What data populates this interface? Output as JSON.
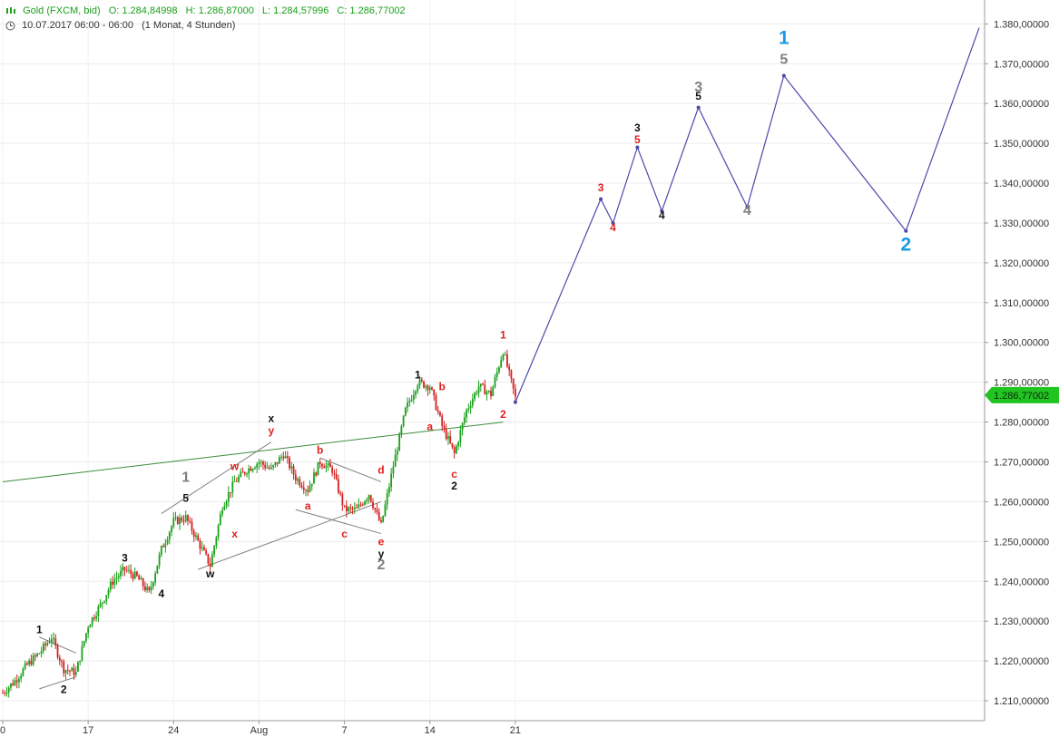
{
  "header": {
    "instrument": "Gold (FXCM, bid)",
    "open": "O: 1.284,84998",
    "high": "H: 1.286,87000",
    "low": "L: 1.284,57996",
    "close": "C: 1.286,77002",
    "date_range": "10.07.2017 06:00 - 06:00",
    "timeframe": "(1 Monat, 4 Stunden)",
    "icon": "candlestick-icon",
    "clock_icon": "clock-icon"
  },
  "colors": {
    "up_candle": "#1aa01a",
    "down_candle": "#d42020",
    "projection": "#4a4aaa",
    "trendline": "#3c8c3c",
    "channel": "#808080",
    "label_red": "#e02020",
    "label_black": "#111111",
    "label_gray": "#808080",
    "label_blue": "#1a9ae6",
    "price_tag": "#22c422"
  },
  "chart_data": {
    "type": "candlestick",
    "y_axis": {
      "position": "right",
      "ylim": [
        1205,
        1386
      ],
      "ticks": [
        1210,
        1220,
        1230,
        1240,
        1250,
        1260,
        1270,
        1280,
        1290,
        1300,
        1310,
        1320,
        1330,
        1340,
        1350,
        1360,
        1370,
        1380
      ],
      "tick_labels": [
        "1.210,00000",
        "1.220,00000",
        "1.230,00000",
        "1.240,00000",
        "1.250,00000",
        "1.260,00000",
        "1.270,00000",
        "1.280,00000",
        "1.290,00000",
        "1.300,00000",
        "1.310,00000",
        "1.320,00000",
        "1.330,00000",
        "1.340,00000",
        "1.350,00000",
        "1.360,00000",
        "1.370,00000",
        "1.380,00000"
      ],
      "grid": true
    },
    "x_axis": {
      "xlim": [
        "2017-07-10",
        "2017-09-05"
      ],
      "ticks": [
        {
          "date": "2017-07-10",
          "label": "0"
        },
        {
          "date": "2017-07-17",
          "label": "17"
        },
        {
          "date": "2017-07-24",
          "label": "24"
        },
        {
          "date": "2017-07-31",
          "label": "Aug"
        },
        {
          "date": "2017-08-07",
          "label": "7"
        },
        {
          "date": "2017-08-14",
          "label": "14"
        },
        {
          "date": "2017-08-21",
          "label": "21"
        }
      ]
    },
    "last_price": {
      "value": 1286.77,
      "label": "1.286,77002"
    },
    "price_path": [
      [
        "2017-07-10",
        1212
      ],
      [
        "2017-07-11",
        1215
      ],
      [
        "2017-07-12",
        1219
      ],
      [
        "2017-07-13",
        1222
      ],
      [
        "2017-07-14",
        1226
      ],
      [
        "2017-07-15",
        1218
      ],
      [
        "2017-07-16",
        1217
      ],
      [
        "2017-07-17",
        1229
      ],
      [
        "2017-07-18",
        1234
      ],
      [
        "2017-07-19",
        1240
      ],
      [
        "2017-07-20",
        1243
      ],
      [
        "2017-07-21",
        1241
      ],
      [
        "2017-07-22",
        1237
      ],
      [
        "2017-07-23",
        1248
      ],
      [
        "2017-07-24",
        1255
      ],
      [
        "2017-07-25",
        1256
      ],
      [
        "2017-07-26",
        1250
      ],
      [
        "2017-07-27",
        1244
      ],
      [
        "2017-07-28",
        1259
      ],
      [
        "2017-07-29",
        1265
      ],
      [
        "2017-07-30",
        1268
      ],
      [
        "2017-07-31",
        1270
      ],
      [
        "2017-08-01",
        1268
      ],
      [
        "2017-08-02",
        1272
      ],
      [
        "2017-08-03",
        1266
      ],
      [
        "2017-08-04",
        1263
      ],
      [
        "2017-08-05",
        1270
      ],
      [
        "2017-08-06",
        1268
      ],
      [
        "2017-08-07",
        1258
      ],
      [
        "2017-08-08",
        1258
      ],
      [
        "2017-08-09",
        1262
      ],
      [
        "2017-08-10",
        1254
      ],
      [
        "2017-08-11",
        1269
      ],
      [
        "2017-08-12",
        1283
      ],
      [
        "2017-08-13",
        1290
      ],
      [
        "2017-08-14",
        1289
      ],
      [
        "2017-08-15",
        1279
      ],
      [
        "2017-08-16",
        1272
      ],
      [
        "2017-08-17",
        1283
      ],
      [
        "2017-08-18",
        1289
      ],
      [
        "2017-08-19",
        1287
      ],
      [
        "2017-08-20",
        1298
      ],
      [
        "2017-08-21",
        1286
      ]
    ],
    "projection": [
      [
        "2017-08-21",
        1285
      ],
      [
        "2017-08-28",
        1336
      ],
      [
        "2017-08-29",
        1330
      ],
      [
        "2017-08-31",
        1349
      ],
      [
        "2017-09-02",
        1333
      ],
      [
        "2017-09-05",
        1359
      ],
      [
        "2017-09-09",
        1334
      ],
      [
        "2017-09-12",
        1367
      ],
      [
        "2017-09-22",
        1328
      ],
      [
        "2017-09-28",
        1379
      ]
    ],
    "trendline": [
      [
        "2017-07-10",
        1265
      ],
      [
        "2017-08-20",
        1280
      ]
    ],
    "channels": [
      [
        [
          "2017-07-13",
          1226
        ],
        [
          "2017-07-16",
          1222
        ]
      ],
      [
        [
          "2017-07-13",
          1213
        ],
        [
          "2017-07-16",
          1216
        ]
      ],
      [
        [
          "2017-07-23",
          1257
        ],
        [
          "2017-08-01",
          1275
        ]
      ],
      [
        [
          "2017-07-26",
          1243
        ],
        [
          "2017-08-10",
          1260
        ]
      ],
      [
        [
          "2017-08-05",
          1271
        ],
        [
          "2017-08-10",
          1265
        ]
      ],
      [
        [
          "2017-08-03",
          1258
        ],
        [
          "2017-08-10",
          1252
        ]
      ]
    ],
    "wave_labels": [
      {
        "text": "1",
        "date": "2017-07-13",
        "y": 1227,
        "color": "black",
        "size": "s"
      },
      {
        "text": "2",
        "date": "2017-07-15",
        "y": 1212,
        "color": "black",
        "size": "s"
      },
      {
        "text": "3",
        "date": "2017-07-20",
        "y": 1245,
        "color": "black",
        "size": "s"
      },
      {
        "text": "4",
        "date": "2017-07-23",
        "y": 1236,
        "color": "black",
        "size": "s"
      },
      {
        "text": "1",
        "date": "2017-07-25",
        "y": 1265,
        "color": "gray",
        "size": "l"
      },
      {
        "text": "5",
        "date": "2017-07-25",
        "y": 1260,
        "color": "black",
        "size": "s"
      },
      {
        "text": "w",
        "date": "2017-07-29",
        "y": 1268,
        "color": "red",
        "size": "s"
      },
      {
        "text": "x",
        "date": "2017-07-29",
        "y": 1251,
        "color": "red",
        "size": "s"
      },
      {
        "text": "w",
        "date": "2017-07-27",
        "y": 1241,
        "color": "black",
        "size": "s"
      },
      {
        "text": "x",
        "date": "2017-08-01",
        "y": 1280,
        "color": "black",
        "size": "s"
      },
      {
        "text": "y",
        "date": "2017-08-01",
        "y": 1277,
        "color": "red",
        "size": "s"
      },
      {
        "text": "b",
        "date": "2017-08-05",
        "y": 1272,
        "color": "red",
        "size": "s"
      },
      {
        "text": "a",
        "date": "2017-08-04",
        "y": 1258,
        "color": "red",
        "size": "s"
      },
      {
        "text": "c",
        "date": "2017-08-07",
        "y": 1251,
        "color": "red",
        "size": "s"
      },
      {
        "text": "d",
        "date": "2017-08-10",
        "y": 1267,
        "color": "red",
        "size": "s"
      },
      {
        "text": "e",
        "date": "2017-08-10",
        "y": 1249,
        "color": "red",
        "size": "s"
      },
      {
        "text": "y",
        "date": "2017-08-10",
        "y": 1246,
        "color": "black",
        "size": "s"
      },
      {
        "text": "2",
        "date": "2017-08-10",
        "y": 1243,
        "color": "gray",
        "size": "l"
      },
      {
        "text": "1",
        "date": "2017-08-13",
        "y": 1291,
        "color": "black",
        "size": "s"
      },
      {
        "text": "b",
        "date": "2017-08-15",
        "y": 1288,
        "color": "red",
        "size": "s"
      },
      {
        "text": "a",
        "date": "2017-08-14",
        "y": 1278,
        "color": "red",
        "size": "s"
      },
      {
        "text": "c",
        "date": "2017-08-16",
        "y": 1266,
        "color": "red",
        "size": "s"
      },
      {
        "text": "2",
        "date": "2017-08-16",
        "y": 1263,
        "color": "black",
        "size": "s"
      },
      {
        "text": "1",
        "date": "2017-08-20",
        "y": 1301,
        "color": "red",
        "size": "s"
      },
      {
        "text": "2",
        "date": "2017-08-20",
        "y": 1281,
        "color": "red",
        "size": "s"
      },
      {
        "text": "3",
        "date": "2017-08-28",
        "y": 1338,
        "color": "red",
        "size": "s"
      },
      {
        "text": "4",
        "date": "2017-08-29",
        "y": 1328,
        "color": "red",
        "size": "s"
      },
      {
        "text": "3",
        "date": "2017-08-31",
        "y": 1353,
        "color": "black",
        "size": "s"
      },
      {
        "text": "5",
        "date": "2017-08-31",
        "y": 1350,
        "color": "red",
        "size": "s"
      },
      {
        "text": "4",
        "date": "2017-09-02",
        "y": 1331,
        "color": "black",
        "size": "s"
      },
      {
        "text": "3",
        "date": "2017-09-05",
        "y": 1363,
        "color": "gray",
        "size": "l"
      },
      {
        "text": "5",
        "date": "2017-09-05",
        "y": 1361,
        "color": "black",
        "size": "s"
      },
      {
        "text": "4",
        "date": "2017-09-09",
        "y": 1332,
        "color": "gray",
        "size": "l"
      },
      {
        "text": "1",
        "date": "2017-09-12",
        "y": 1375,
        "color": "blue",
        "size": "xl"
      },
      {
        "text": "5",
        "date": "2017-09-12",
        "y": 1370,
        "color": "gray",
        "size": "l"
      },
      {
        "text": "2",
        "date": "2017-09-22",
        "y": 1323,
        "color": "blue",
        "size": "xl"
      }
    ]
  }
}
